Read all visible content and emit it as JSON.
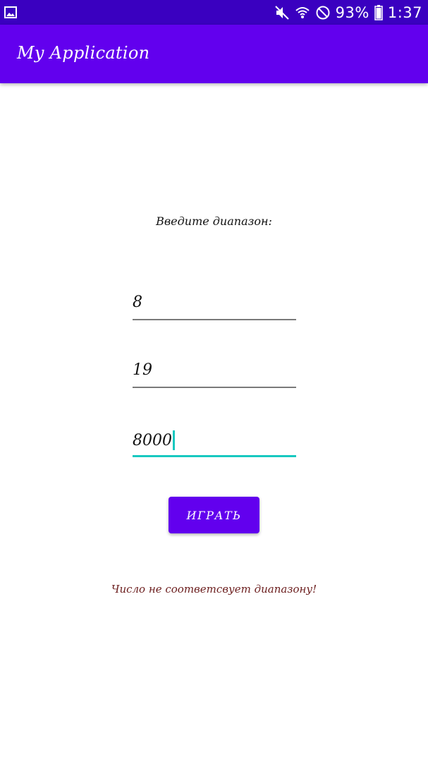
{
  "status_bar": {
    "left_icon": "gallery-icon",
    "icons": [
      "mute-icon",
      "wifi-icon",
      "do-not-disturb-icon",
      "battery-icon"
    ],
    "battery": "93%",
    "time": "1:37"
  },
  "app_bar": {
    "title": "My Application"
  },
  "form": {
    "prompt": "Введите диапазон:",
    "fields": [
      {
        "value": "8"
      },
      {
        "value": "19"
      },
      {
        "value": "8000"
      }
    ],
    "button_label": "ИГРАТЬ"
  },
  "message": "Число не соответсвует диапазону!",
  "colors": {
    "status_bar": "#3a00c0",
    "primary": "#6200ee",
    "accent": "#18c8c0",
    "error_text": "#6b1d1d"
  }
}
